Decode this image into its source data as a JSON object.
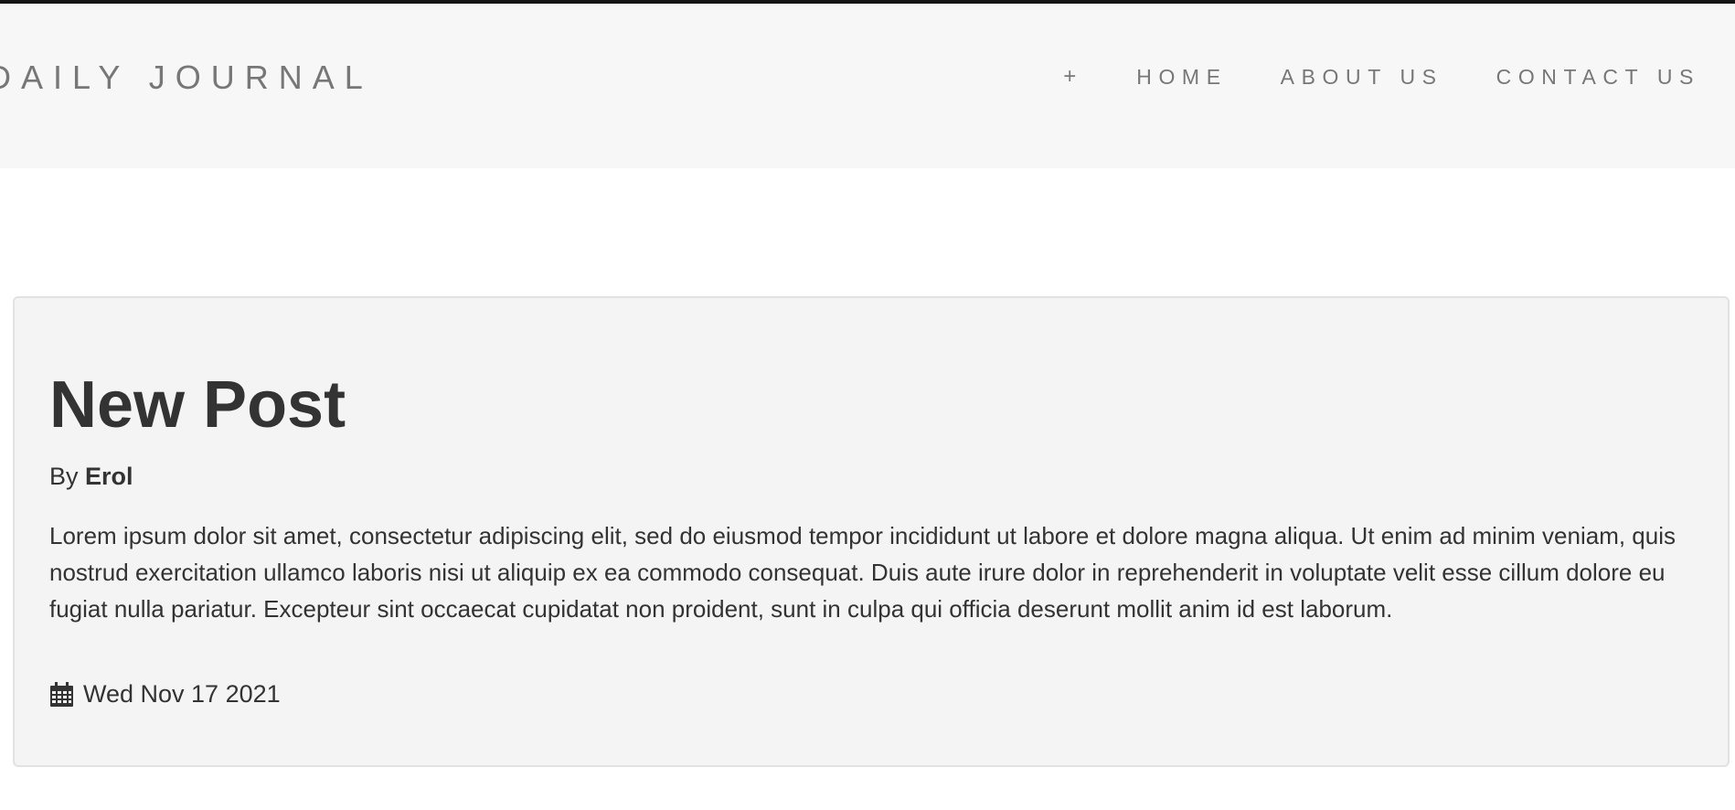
{
  "navbar": {
    "brand": "DAILY JOURNAL",
    "items": [
      {
        "label": "+",
        "icon": "plus-icon"
      },
      {
        "label": "HOME"
      },
      {
        "label": "ABOUT US"
      },
      {
        "label": "CONTACT US"
      }
    ]
  },
  "post": {
    "title": "New Post",
    "by_prefix": "By",
    "author": "Erol",
    "body": "Lorem ipsum dolor sit amet, consectetur adipiscing elit, sed do eiusmod tempor incididunt ut labore et dolore magna aliqua. Ut enim ad minim veniam, quis nostrud exercitation ullamco laboris nisi ut aliquip ex ea commodo consequat. Duis aute irure dolor in reprehenderit in voluptate velit esse cillum dolore eu fugiat nulla pariatur. Excepteur sint occaecat cupidatat non proident, sunt in culpa qui officia deserunt mollit anim id est laborum.",
    "date": "Wed Nov 17 2021",
    "date_icon": "calendar-icon"
  },
  "colors": {
    "nav_background": "#f7f7f7",
    "nav_text": "#777777",
    "card_background": "#f4f4f4",
    "card_border": "#e2e2e2",
    "body_text": "#333333"
  }
}
